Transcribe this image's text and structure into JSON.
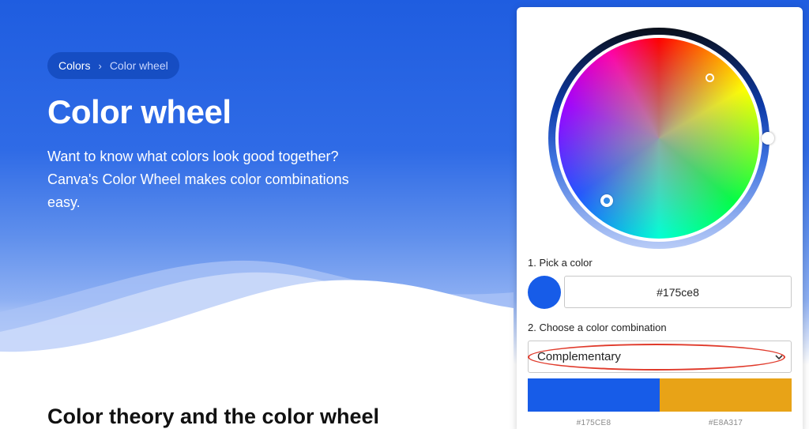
{
  "breadcrumb": {
    "root": "Colors",
    "separator": "›",
    "current": "Color wheel"
  },
  "hero": {
    "title": "Color wheel",
    "description": "Want to know what colors look good together? Canva's Color Wheel makes color combinations easy."
  },
  "section": {
    "title": "Color theory and the color wheel"
  },
  "picker": {
    "step1_label": "1. Pick a color",
    "hex_value": "#175ce8",
    "selected_color": "#175ce8",
    "step2_label": "2. Choose a color combination",
    "combination": "Complementary",
    "icons": {
      "dropdown": "chevron-down-icon"
    },
    "palette": [
      {
        "color": "#175CE8",
        "label": "#175CE8"
      },
      {
        "color": "#E8A317",
        "label": "#E8A317"
      }
    ]
  },
  "colors": {
    "brand": "#1f5de0",
    "annotation": "#e03a2b"
  }
}
